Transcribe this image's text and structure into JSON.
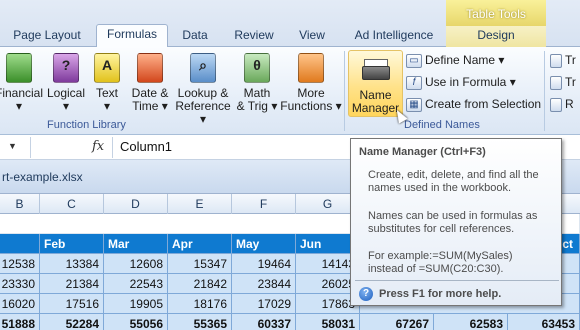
{
  "tabs": {
    "page_layout": "Page Layout",
    "formulas": "Formulas",
    "data": "Data",
    "review": "Review",
    "view": "View",
    "ad_intelligence": "Ad Intelligence",
    "table_tools_header": "Table Tools",
    "design": "Design"
  },
  "ribbon": {
    "function_library": {
      "label": "Function Library",
      "buttons": {
        "financial": "Financial",
        "logical": "Logical",
        "text": "Text",
        "date_time_1": "Date &",
        "date_time_2": "Time",
        "lookup_1": "Lookup &",
        "lookup_2": "Reference",
        "math_1": "Math",
        "math_2": "& Trig",
        "more_1": "More",
        "more_2": "Functions"
      }
    },
    "defined_names": {
      "label": "Defined Names",
      "name_manager_1": "Name",
      "name_manager_2": "Manager",
      "define_name": "Define Name",
      "use_in_formula": "Use in Formula",
      "create_from_selection": "Create from Selection"
    },
    "right_edge": {
      "r1": "Tr",
      "r2": "Tr",
      "r3": "R"
    }
  },
  "formula_bar": {
    "fx": "fx",
    "value": "Column1"
  },
  "workbook": {
    "title": "rt-example.xlsx"
  },
  "columns": [
    "B",
    "C",
    "D",
    "E",
    "F",
    "G"
  ],
  "table": {
    "header": [
      "",
      "Feb",
      "Mar",
      "Apr",
      "May",
      "Jun"
    ],
    "rows": [
      [
        "12538",
        "13384",
        "12608",
        "15347",
        "19464",
        "14143"
      ],
      [
        "23330",
        "21384",
        "22543",
        "21842",
        "23844",
        "26025"
      ],
      [
        "16020",
        "17516",
        "19905",
        "18176",
        "17029",
        "17863"
      ]
    ],
    "total": [
      "51888",
      "52284",
      "55056",
      "55365",
      "60337",
      "58031",
      "67267",
      "62583",
      "63453"
    ],
    "right_header": "ct"
  },
  "tooltip": {
    "title": "Name Manager (Ctrl+F3)",
    "p1": "Create, edit, delete, and find all the names used in the workbook.",
    "p2": "Names can be used in formulas as substitutes for cell references.",
    "p3a": "For example:=SUM(MySales)",
    "p3b": "instead of =SUM(C20:C30).",
    "help": "Press F1 for more help."
  },
  "colors": {
    "accent": "#0f7ad0",
    "data_fill": "#cfe3f7",
    "context_tab": "#e7d66b"
  }
}
